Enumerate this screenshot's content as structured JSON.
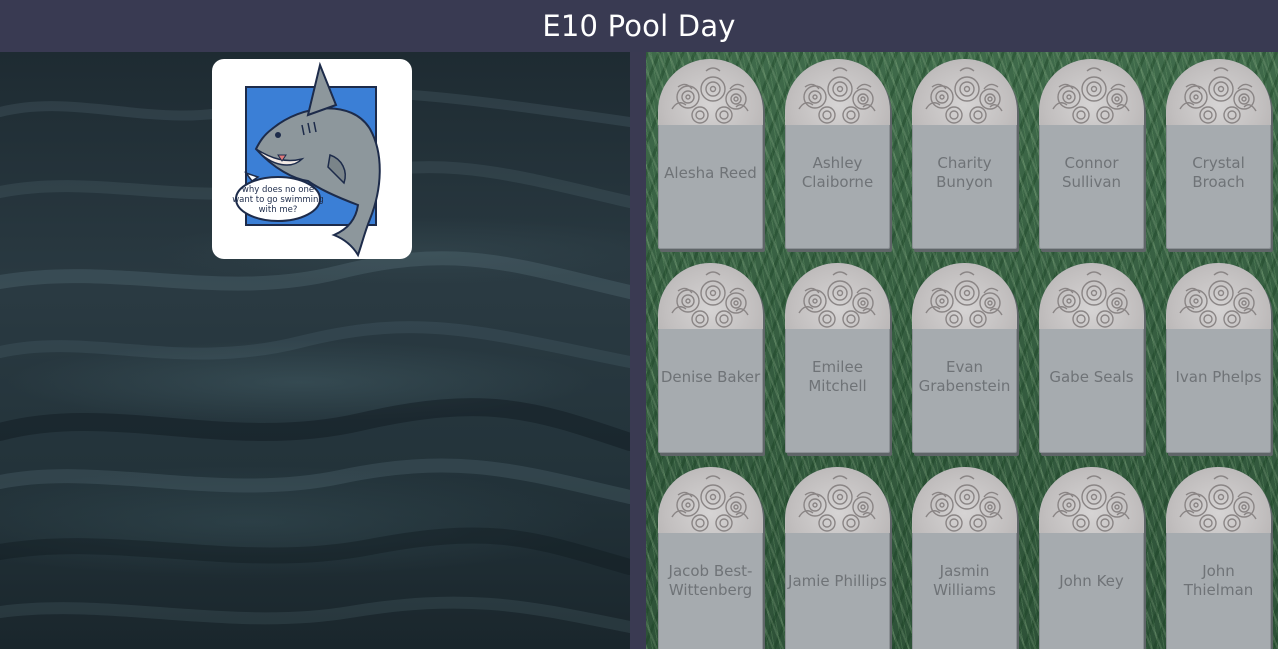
{
  "header": {
    "title": "E10 Pool Day"
  },
  "shark": {
    "speech": [
      "why does no one",
      "want to go swimming",
      "with me?"
    ]
  },
  "graves": [
    {
      "name": "Alesha Reed"
    },
    {
      "name": "Ashley Claiborne"
    },
    {
      "name": "Charity Bunyon"
    },
    {
      "name": "Connor Sullivan"
    },
    {
      "name": "Crystal Broach"
    },
    {
      "name": "Denise Baker"
    },
    {
      "name": "Emilee Mitchell"
    },
    {
      "name": "Evan Grabenstein"
    },
    {
      "name": "Gabe Seals"
    },
    {
      "name": "Ivan Phelps"
    },
    {
      "name": "Jacob Best-Wittenberg"
    },
    {
      "name": "Jamie Phillips"
    },
    {
      "name": "Jasmin Williams"
    },
    {
      "name": "John Key"
    },
    {
      "name": "John Thielman"
    }
  ],
  "colors": {
    "header_bg": "#393a52",
    "header_text": "#ffffff",
    "stone": "#a6abaf",
    "stone_text": "#6f7377",
    "grass": "#355d40",
    "water": "#23333a",
    "shark_frame": "#3b7fd6"
  }
}
